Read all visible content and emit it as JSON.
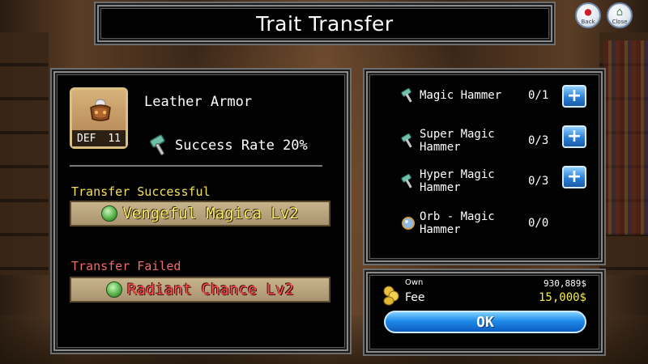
{
  "header": {
    "title": "Trait Transfer",
    "back_label": "Back",
    "close_label": "Close"
  },
  "item": {
    "name": "Leather Armor",
    "stat_label": "DEF",
    "stat_value": "11",
    "icon": "leather-armor-icon"
  },
  "success_rate": {
    "label": "Success Rate 20%",
    "icon": "hammer-icon"
  },
  "results": {
    "success_label": "Transfer Successful",
    "success_trait": "Vengeful Magica Lv2",
    "failed_label": "Transfer Failed",
    "failed_trait": "Radiant Chance Lv2"
  },
  "materials": [
    {
      "name": "Magic Hammer",
      "count": "0/1",
      "icon": "magic-hammer-icon",
      "has_add": true
    },
    {
      "name": "Super Magic Hammer",
      "count": "0/3",
      "icon": "super-magic-hammer-icon",
      "has_add": true
    },
    {
      "name": "Hyper Magic Hammer",
      "count": "0/3",
      "icon": "hyper-magic-hammer-icon",
      "has_add": true
    },
    {
      "name": "Orb - Magic Hammer",
      "count": "0/0",
      "icon": "orb-icon",
      "has_add": false
    }
  ],
  "add_button_label": "+",
  "fee": {
    "own_label": "Own",
    "own_value": "930,889$",
    "fee_label": "Fee",
    "fee_value": "15,000$"
  },
  "ok_label": "OK",
  "colors": {
    "success_text": "#f4e05a",
    "failed_text": "#f06a6a",
    "fee_value": "#f7ee3c",
    "button_blue": "#1e8be8"
  }
}
